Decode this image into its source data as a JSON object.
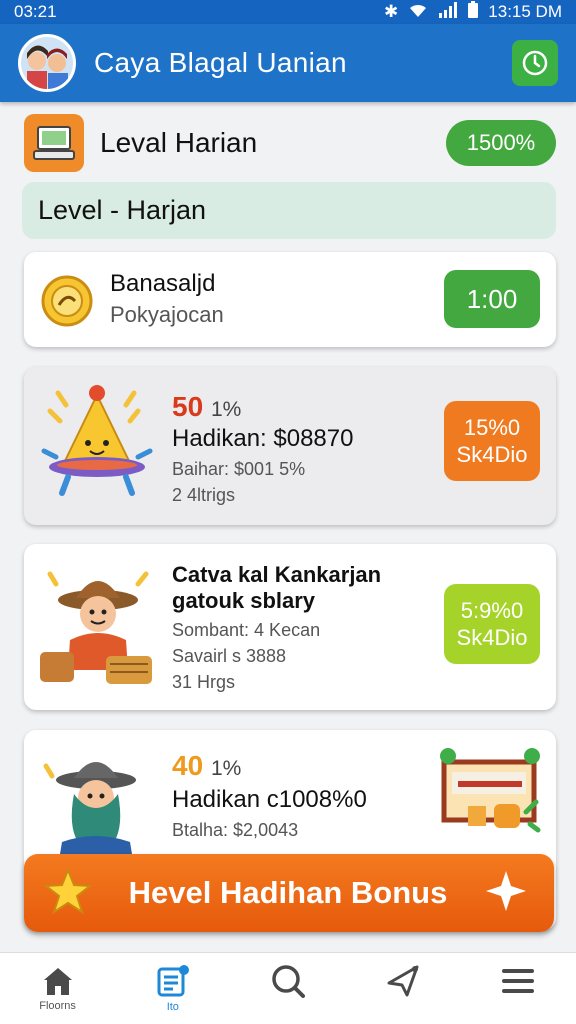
{
  "status": {
    "time_left": "03:21",
    "time_right": "13:15 DM"
  },
  "app": {
    "title": "Caya Blagal Uanian"
  },
  "level": {
    "title": "Leval Harian",
    "pill": "1500%"
  },
  "subheader": "Level - Harjan",
  "card1": {
    "title": "Banasaljd",
    "subtitle": "Pokyajocan",
    "badge": "1:00"
  },
  "card2": {
    "pct": "50",
    "pct_suffix": "1%",
    "line1": "Hadikan: $08870",
    "line2": "Baihar: $001 5%",
    "line3": "2 4ltrigs",
    "badge_line1": "15%0",
    "badge_line2": "Sk4Dio"
  },
  "card3": {
    "title1": "Catva kal Kankarjan",
    "title2": "gatouk sblary",
    "line1": "Sombant: 4 Kecan",
    "line2": "Savairl s 3888",
    "line3": "31 Hrgs",
    "badge_line1": "5:9%0",
    "badge_line2": "Sk4Dio"
  },
  "card4": {
    "pct": "40",
    "pct_suffix": "1%",
    "line1": "Hadikan c1008%0",
    "line2": "Btalha: $2,0043"
  },
  "bonus": {
    "label": "Hevel Hadihan Bonus"
  },
  "nav": [
    {
      "label": "Floorns",
      "icon": "home-icon"
    },
    {
      "label": "Ito",
      "icon": "document-icon"
    },
    {
      "label": "",
      "icon": "search-icon"
    },
    {
      "label": "",
      "icon": "send-icon"
    },
    {
      "label": "",
      "icon": "menu-icon"
    }
  ],
  "colors": {
    "primary": "#1e73c9",
    "green": "#43a83f",
    "orange": "#f07a20",
    "lime": "#a6d32a",
    "red_pct": "#d93a1a",
    "orange_pct": "#ee9a1e"
  }
}
